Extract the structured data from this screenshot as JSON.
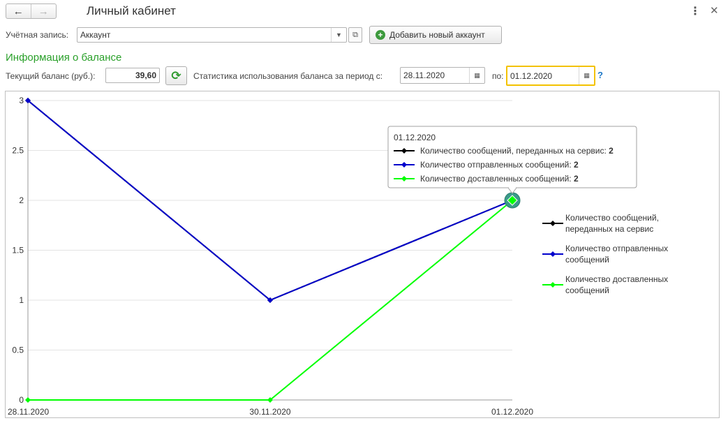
{
  "window": {
    "title": "Личный кабинет",
    "back_icon": "arrow-left-icon",
    "forward_icon": "arrow-right-icon",
    "more_icon": "vertical-dots-icon",
    "close_icon": "close-icon"
  },
  "account": {
    "label": "Учётная запись:",
    "value": "Аккаунт",
    "add_button_label": "Добавить новый аккаунт"
  },
  "balance": {
    "section_title": "Информация о балансе",
    "current_label": "Текущий баланс (руб.):",
    "current_value": "39,60",
    "stats_label": "Статистика использования баланса за период с:",
    "date_from": "28.11.2020",
    "date_to_label": "по:",
    "date_to": "01.12.2020",
    "help": "?"
  },
  "colors": {
    "accent_green": "#2aa02a",
    "focus_border": "#f3c200",
    "series_black": "#000000",
    "series_blue": "#0000cc",
    "series_green": "#00ff00"
  },
  "chart_data": {
    "type": "line",
    "x": [
      "28.11.2020",
      "30.11.2020",
      "01.12.2020"
    ],
    "ylim": [
      0,
      3
    ],
    "yticks": [
      "0",
      "0.5",
      "1",
      "1.5",
      "2",
      "2.5",
      "3"
    ],
    "grid": true,
    "legend_position": "right",
    "series": [
      {
        "name": "Количество сообщений, переданных на сервис",
        "legend_lines": [
          "Количество сообщений,",
          "переданных на сервис"
        ],
        "color": "#000000",
        "values": [
          3,
          1,
          2
        ]
      },
      {
        "name": "Количество отправленных сообщений",
        "legend_lines": [
          "Количество отправленных",
          "сообщений"
        ],
        "color": "#0000cc",
        "values": [
          3,
          1,
          2
        ]
      },
      {
        "name": "Количество доставленных сообщений",
        "legend_lines": [
          "Количество доставленных",
          "сообщений"
        ],
        "color": "#00ff00",
        "values": [
          0,
          0,
          2
        ]
      }
    ],
    "tooltip": {
      "date": "01.12.2020",
      "items": [
        {
          "label": "Количество сообщений, переданных на сервис:",
          "value": "2"
        },
        {
          "label": "Количество отправленных сообщений:",
          "value": "2"
        },
        {
          "label": "Количество доставленных сообщений:",
          "value": "2"
        }
      ]
    }
  }
}
